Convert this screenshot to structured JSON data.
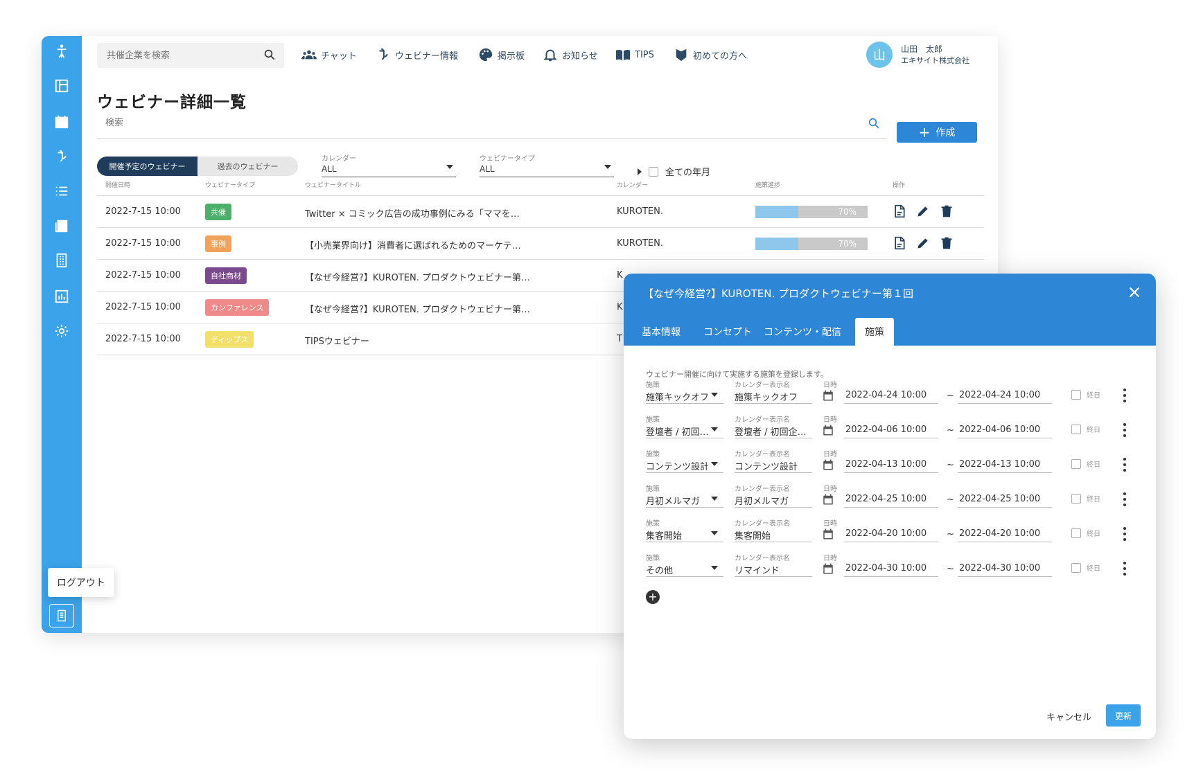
{
  "search": {
    "company_placeholder": "共催企業を検索",
    "main_placeholder": "検索"
  },
  "nav": [
    {
      "label": "チャット"
    },
    {
      "label": "ウェビナー情報"
    },
    {
      "label": "掲示板"
    },
    {
      "label": "お知らせ"
    },
    {
      "label": "TIPS"
    },
    {
      "label": "初めての方へ"
    }
  ],
  "user": {
    "avatar": "山",
    "name": "山田　太郎",
    "company": "エキサイト株式会社"
  },
  "page": {
    "title": "ウェビナー詳細一覧",
    "create_label": "作成"
  },
  "segment": {
    "upcoming": "開催予定のウェビナー",
    "past": "過去のウェビナー"
  },
  "filters": {
    "calendar_label": "カレンダー",
    "calendar_value": "ALL",
    "type_label": "ウェビナータイプ",
    "type_value": "ALL",
    "all_months": "全ての年月"
  },
  "table": {
    "headers": [
      "開催日時",
      "ウェビナータイプ",
      "ウェビナータイトル",
      "カレンダー",
      "施策進捗",
      "操作"
    ],
    "rows": [
      {
        "date": "2022-7-15 10:00",
        "type": "共催",
        "type_color": "#4caf6a",
        "title": "Twitter × コミック広告の成功事例にみる「ママを…",
        "calendar": "KUROTEN.",
        "progress": "70%"
      },
      {
        "date": "2022-7-15 10:00",
        "type": "事例",
        "type_color": "#f2a35a",
        "title": "【小売業界向け】消費者に選ばれるためのマーケテ…",
        "calendar": "KUROTEN.",
        "progress": "70%"
      },
      {
        "date": "2022-7-15 10:00",
        "type": "自社商材",
        "type_color": "#7a4a8c",
        "title": "【なぜ今経営?】KUROTEN. プロダクトウェビナー第…",
        "calendar": "K"
      },
      {
        "date": "2022-7-15 10:00",
        "type": "カンファレンス",
        "type_color": "#f08a8a",
        "title": "【なぜ今経営?】KUROTEN. プロダクトウェビナー第…",
        "calendar": "K"
      },
      {
        "date": "2022-7-15 10:00",
        "type": "ティップス",
        "type_color": "#f2e06a",
        "title": "TIPSウェビナー",
        "calendar": "T"
      }
    ]
  },
  "sidebar": {
    "logout": "ログアウト"
  },
  "dialog": {
    "title": "【なぜ今経営?】KUROTEN. プロダクトウェビナー第１回",
    "tabs": [
      "基本情報",
      "コンセプト",
      "コンテンツ・配信",
      "施策"
    ],
    "active_tab": "施策",
    "description": "ウェビナー開催に向けて実施する施策を登録します。",
    "field_labels": {
      "measure": "施策",
      "calendar_name": "カレンダー表示名",
      "datetime": "日時",
      "allday": "終日",
      "tilde": "~"
    },
    "measures": [
      {
        "measure": "施策キックオフ",
        "calendar_name": "施策キックオフ",
        "start": "2022-04-24 10:00",
        "end": "2022-04-24 10:00"
      },
      {
        "measure": "登壇者 / 初回…",
        "calendar_name": "登壇者 / 初回企…",
        "start": "2022-04-06 10:00",
        "end": "2022-04-06 10:00"
      },
      {
        "measure": "コンテンツ設計",
        "calendar_name": "コンテンツ設計",
        "start": "2022-04-13 10:00",
        "end": "2022-04-13 10:00"
      },
      {
        "measure": "月初メルマガ",
        "calendar_name": "月初メルマガ",
        "start": "2022-04-25 10:00",
        "end": "2022-04-25 10:00"
      },
      {
        "measure": "集客開始",
        "calendar_name": "集客開始",
        "start": "2022-04-20 10:00",
        "end": "2022-04-20 10:00"
      },
      {
        "measure": "その他",
        "calendar_name": "リマインド",
        "start": "2022-04-30 10:00",
        "end": "2022-04-30 10:00"
      }
    ],
    "cancel": "キャンセル",
    "update": "更新"
  },
  "colors": {
    "primary": "#2e86d6",
    "sidebar": "#3ba3ea",
    "navy": "#1f3d5a"
  }
}
